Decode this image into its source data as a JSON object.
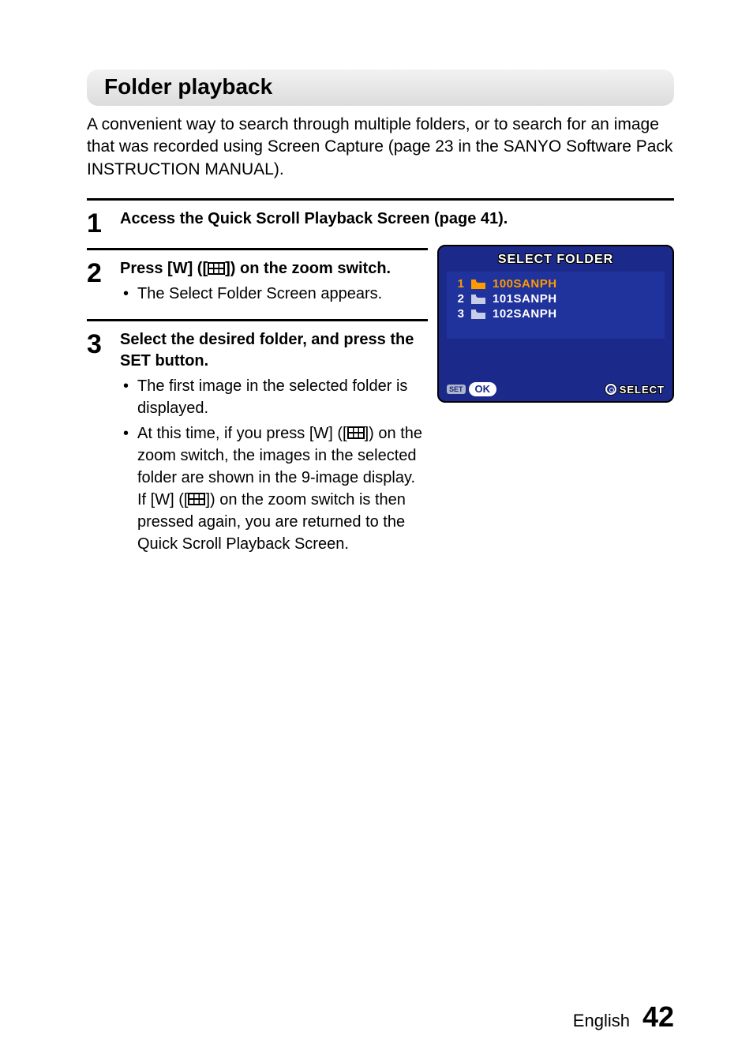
{
  "heading": "Folder playback",
  "intro": "A convenient way to search through multiple folders, or to search for an image that was recorded using Screen Capture (page 23 in the SANYO Software Pack INSTRUCTION MANUAL).",
  "steps": {
    "s1": {
      "num": "1",
      "title": "Access the Quick Scroll Playback Screen (page 41)."
    },
    "s2": {
      "num": "2",
      "title_a": "Press [W] ([",
      "title_b": "]) on the zoom switch.",
      "sub1": "The Select Folder Screen appears."
    },
    "s3": {
      "num": "3",
      "title": "Select the desired folder, and press the SET button.",
      "sub1": "The first image in the selected folder is displayed.",
      "sub2_a": "At this time, if you press [W] ([",
      "sub2_b": "]) on the zoom switch, the images in the selected folder are shown in the 9-image display. If [W] ([",
      "sub2_c": "]) on the zoom switch is then pressed again, you are returned to the Quick Scroll Playback Screen."
    }
  },
  "screen": {
    "title": "SELECT FOLDER",
    "folders": [
      {
        "n": "1",
        "name": "100SANPH"
      },
      {
        "n": "2",
        "name": "101SANPH"
      },
      {
        "n": "3",
        "name": "102SANPH"
      }
    ],
    "footer_set_badge": "SET",
    "footer_ok": "OK",
    "footer_select": "SELECT"
  },
  "footer": {
    "lang": "English",
    "page": "42"
  }
}
